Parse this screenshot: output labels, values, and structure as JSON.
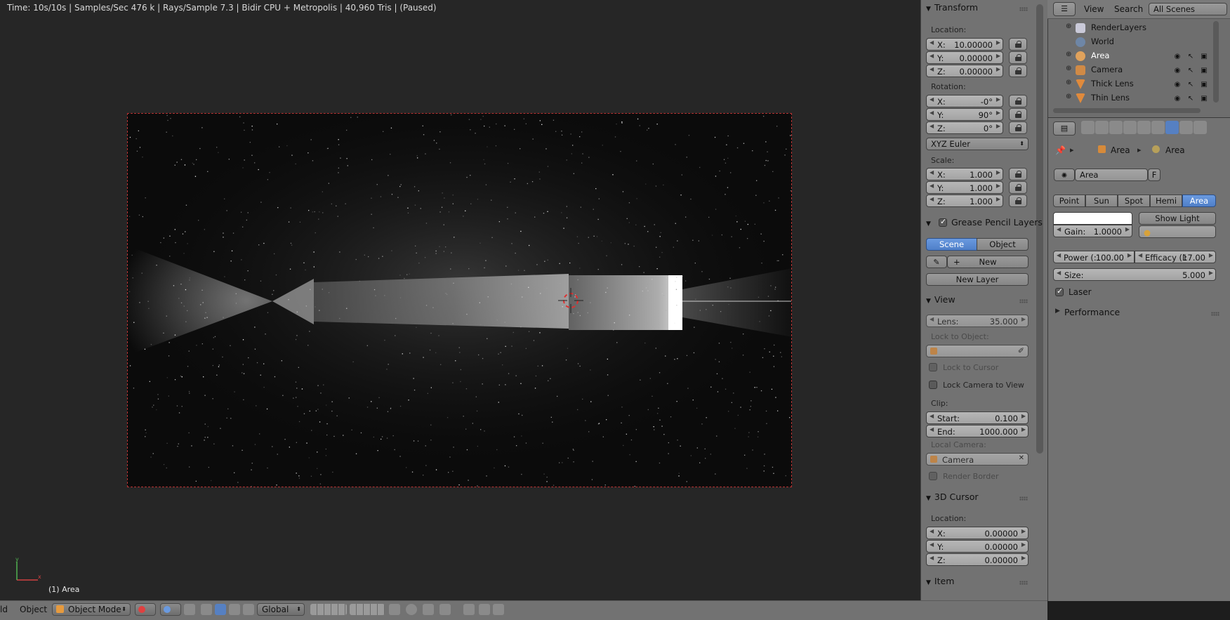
{
  "viewport": {
    "status_line": "Time: 10s/10s | Samples/Sec 476 k | Rays/Sample 7.3 | Bidir CPU + Metropolis | 40,960 Tris | (Paused)",
    "selected_label": "(1) Area",
    "axis_x": "x",
    "axis_y": "y"
  },
  "bottom_bar": {
    "view_menu": "ld",
    "object_menu": "Object",
    "mode": "Object Mode",
    "orientation": "Global"
  },
  "npanel": {
    "transform": {
      "title": "Transform",
      "location_label": "Location:",
      "location": [
        {
          "axis": "X:",
          "value": "10.00000"
        },
        {
          "axis": "Y:",
          "value": "0.00000"
        },
        {
          "axis": "Z:",
          "value": "0.00000"
        }
      ],
      "rotation_label": "Rotation:",
      "rotation": [
        {
          "axis": "X:",
          "value": "-0°"
        },
        {
          "axis": "Y:",
          "value": "90°"
        },
        {
          "axis": "Z:",
          "value": "0°"
        }
      ],
      "rotation_mode": "XYZ Euler",
      "scale_label": "Scale:",
      "scale": [
        {
          "axis": "X:",
          "value": "1.000"
        },
        {
          "axis": "Y:",
          "value": "1.000"
        },
        {
          "axis": "Z:",
          "value": "1.000"
        }
      ]
    },
    "grease_pencil": {
      "title": "Grease Pencil Layers",
      "scene_tab": "Scene",
      "object_tab": "Object",
      "new_label": "New",
      "new_layer_label": "New Layer"
    },
    "view": {
      "title": "View",
      "lens_label": "Lens:",
      "lens_value": "35.000",
      "lock_object_label": "Lock to Object:",
      "lock_cursor_label": "Lock to Cursor",
      "lock_camera_label": "Lock Camera to View",
      "clip_label": "Clip:",
      "clip_start_label": "Start:",
      "clip_start_value": "0.100",
      "clip_end_label": "End:",
      "clip_end_value": "1000.000",
      "local_camera_label": "Local Camera:",
      "local_camera_value": "Camera",
      "render_border_label": "Render Border"
    },
    "cursor": {
      "title": "3D Cursor",
      "location_label": "Location:",
      "location": [
        {
          "axis": "X:",
          "value": "0.00000"
        },
        {
          "axis": "Y:",
          "value": "0.00000"
        },
        {
          "axis": "Z:",
          "value": "0.00000"
        }
      ]
    },
    "item": {
      "title": "Item"
    }
  },
  "outliner": {
    "view_menu": "View",
    "search_menu": "Search",
    "scene_filter": "All Scenes",
    "items": [
      {
        "name": "RenderLayers",
        "icon": "renderlayers-icon",
        "color": "#c9c9d8"
      },
      {
        "name": "World",
        "icon": "world-icon",
        "color": "#6e86a6"
      },
      {
        "name": "Area",
        "icon": "lamp-icon",
        "color": "#e0a25c"
      },
      {
        "name": "Camera",
        "icon": "camera-icon",
        "color": "#d08a46"
      },
      {
        "name": "Thick Lens",
        "icon": "mesh-icon",
        "color": "#e08a3c"
      },
      {
        "name": "Thin Lens",
        "icon": "mesh-icon",
        "color": "#e08a3c"
      }
    ]
  },
  "properties": {
    "breadcrumb_object": "Area",
    "breadcrumb_data": "Area",
    "datablock_name": "Area",
    "fake_user": "F",
    "lamp_types": [
      "Point",
      "Sun",
      "Spot",
      "Hemi",
      "Area"
    ],
    "active_lamp_type": "Area",
    "show_light_groups": "Show Light Groups",
    "gain_label": "Gain:",
    "gain_value": "1.0000",
    "power_label": "Power (:",
    "power_value": "100.00",
    "efficacy_label": "Efficacy (l:",
    "efficacy_value": "17.00",
    "size_label": "Size:",
    "size_value": "5.000",
    "laser_label": "Laser",
    "performance_label": "Performance"
  },
  "colors": {
    "accent": "#5680c2",
    "panel": "#727272",
    "frame_border": "#b83232"
  }
}
